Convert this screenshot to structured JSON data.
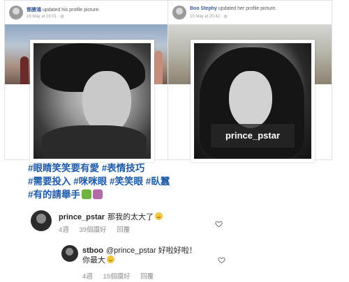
{
  "posts": [
    {
      "name": "鄧勝鴻",
      "action": "updated his profile picture.",
      "time": "16 May at 16:01 · "
    },
    {
      "name": "Boo Stephy",
      "action": "updated her profile picture.",
      "time": "15 May at 20:42 · "
    }
  ],
  "watermark": "prince_pstar",
  "caption": {
    "line1": "#眼睛笑笑要有愛 #表情技巧",
    "line2": "#需要投入 #咪咪眼 #笑笑眼 #臥蠶",
    "line3": "#有的請舉手"
  },
  "comments": [
    {
      "user": "prince_pstar",
      "text": "那我的太大了",
      "time": "4週",
      "likes": "39個讚好",
      "reply": "回覆"
    },
    {
      "user": "stboo",
      "text": "@prince_pstar 好啦好啦！",
      "text2": "你最大",
      "time": "4週",
      "likes": "15個讚好",
      "reply": "回覆"
    }
  ],
  "colors": {
    "hashtag": "#1d5aa8",
    "link_name": "#365899",
    "meta": "#8e8e8e"
  },
  "icons": [
    "globe-icon",
    "heart-icon",
    "raising-hand-emoji",
    "smile-emoji"
  ]
}
